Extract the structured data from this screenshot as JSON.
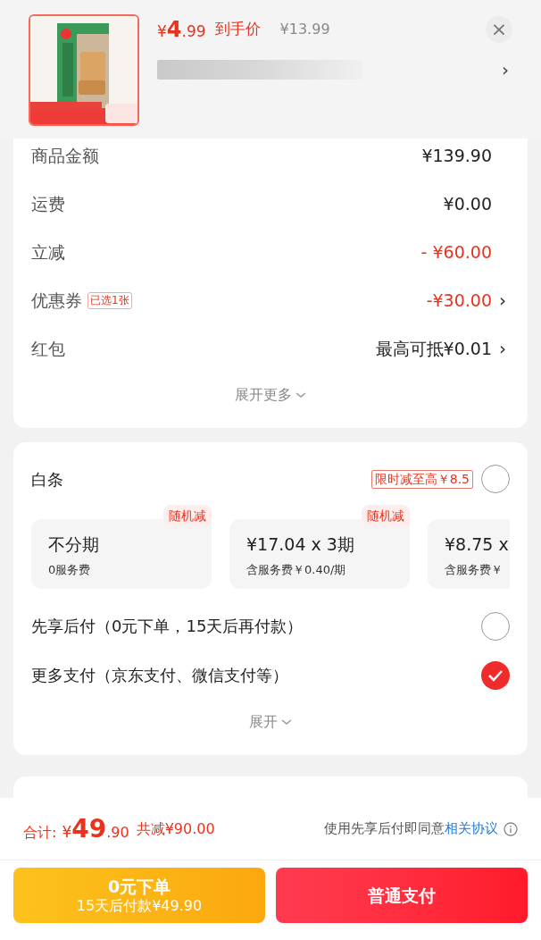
{
  "product": {
    "price_symbol": "¥",
    "price_int": "4",
    "price_dec": ".99",
    "price_label": "到手价",
    "original_price": "¥13.99",
    "close": "×",
    "title_chevron": "›"
  },
  "summary": {
    "rows": [
      {
        "label": "商品金额",
        "value": "¥139.90",
        "discount": false
      },
      {
        "label": "运费",
        "value": "¥0.00",
        "discount": false
      },
      {
        "label": "立减",
        "value": "- ¥60.00",
        "discount": true
      },
      {
        "label": "优惠券",
        "badge": "已选1张",
        "value": "-¥30.00",
        "discount": true,
        "chevron": "›"
      },
      {
        "label": "红包",
        "value": "最高可抵¥0.01",
        "discount": false,
        "chevron": "›"
      }
    ],
    "expand": "展开更多"
  },
  "payment": {
    "baitiao": {
      "label": "白条",
      "promo": "限时减至高￥8.5",
      "selected": false
    },
    "plans": [
      {
        "title": "不分期",
        "fee": "0服务费",
        "tag": "随机减"
      },
      {
        "title": "¥17.04 x 3期",
        "fee": "含服务费￥0.40/期",
        "tag": "随机减"
      },
      {
        "title": "¥8.75 x",
        "fee": "含服务费￥"
      }
    ],
    "options": [
      {
        "label": "先享后付（0元下单，15天后再付款）",
        "selected": false
      },
      {
        "label": "更多支付（京东支付、微信支付等）",
        "selected": true
      }
    ],
    "expand": "展开"
  },
  "footer": {
    "total_label": "合计:",
    "total_symbol": "¥",
    "total_int": "49",
    "total_dec": ".90",
    "saved": "共减¥90.00",
    "agreement_text": "使用先享后付即同意",
    "agreement_link": "相关协议",
    "buttons": [
      {
        "kind": "later",
        "title": "0元下单",
        "subtitle": "15天后付款¥49.90"
      },
      {
        "kind": "pay",
        "title": "普通支付"
      }
    ]
  }
}
